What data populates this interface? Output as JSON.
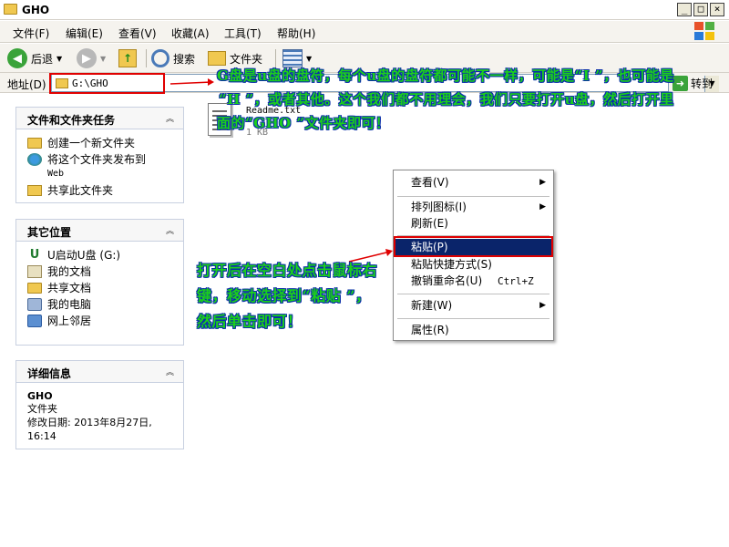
{
  "window": {
    "title": "GHO"
  },
  "window_controls": {
    "minimize": "_",
    "maximize": "□",
    "close": "×"
  },
  "menubar": {
    "file": "文件(F)",
    "edit": "编辑(E)",
    "view": "查看(V)",
    "favorites": "收藏(A)",
    "tools": "工具(T)",
    "help": "帮助(H)"
  },
  "toolbar": {
    "back": "后退",
    "search": "搜索",
    "folders": "文件夹"
  },
  "address": {
    "label": "地址(D)",
    "path": "G:\\GHO",
    "go": "转到"
  },
  "panels": {
    "tasks": {
      "title": "文件和文件夹任务",
      "items": [
        "创建一个新文件夹",
        "将这个文件夹发布到",
        "Web",
        "共享此文件夹"
      ]
    },
    "places": {
      "title": "其它位置",
      "items": [
        "U启动U盘 (G:)",
        "我的文档",
        "共享文档",
        "我的电脑",
        "网上邻居"
      ]
    },
    "details": {
      "title": "详细信息",
      "name": "GHO",
      "type": "文件夹",
      "modified": "修改日期: 2013年8月27日,",
      "time": "16:14"
    }
  },
  "file": {
    "name": "Readme.txt",
    "size": "1 KB"
  },
  "annotations": {
    "top_line1": "G盘是u盘的盘符，每个u盘的盘符都可能不一样，可能是“I ”，也可能是",
    "top_line2": "“H ”，或者其他。这个我们都不用理会，我们只要打开u盘，然后打开里",
    "top_line3": "面的“GHO ”文件夹即可！",
    "left_line1": "打开后在空白处点击鼠标右",
    "left_line2": "键，移动选择到“粘贴 ”，",
    "left_line3": "然后单击即可！"
  },
  "context_menu": {
    "view": "查看(V)",
    "arrange": "排列图标(I)",
    "refresh": "刷新(E)",
    "paste": "粘贴(P)",
    "paste_shortcut": "粘贴快捷方式(S)",
    "undo_rename": "撤销重命名(U)",
    "undo_shortcut": "Ctrl+Z",
    "new": "新建(W)",
    "properties": "属性(R)"
  },
  "colors": {
    "annotation_text": "#1ccf1c",
    "annotation_outline": "#0a2fa8",
    "highlight_box": "#e00000",
    "menu_highlight": "#0a246a"
  }
}
